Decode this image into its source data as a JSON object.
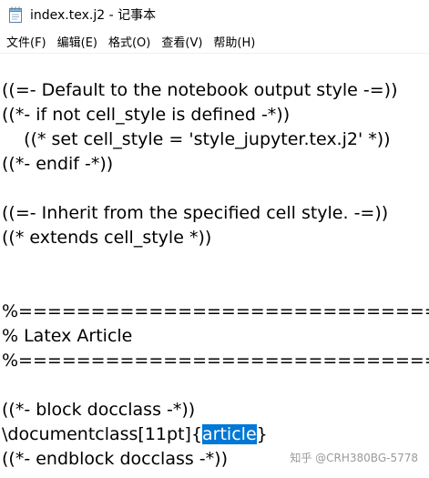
{
  "window": {
    "title": "index.tex.j2 - 记事本"
  },
  "menu": {
    "items": [
      "文件(F)",
      "编辑(E)",
      "格式(O)",
      "查看(V)",
      "帮助(H)"
    ]
  },
  "editor": {
    "lines": [
      "((=- Default to the notebook output style -=))",
      "((*- if not cell_style is defined -*))",
      "    ((* set cell_style = 'style_jupyter.tex.j2' *))",
      "((*- endif -*))",
      "",
      "((=- Inherit from the specified cell style. -=))",
      "((* extends cell_style *))",
      "",
      "",
      "%================================================",
      "% Latex Article",
      "%================================================",
      "",
      "((*- block docclass -*))",
      "",
      "((*- endblock docclass -*))"
    ],
    "docclass_line": {
      "prefix": "\\documentclass[11pt]{",
      "selected": "article",
      "suffix": "}"
    }
  },
  "watermark": "知乎 @CRH380BG-5778"
}
